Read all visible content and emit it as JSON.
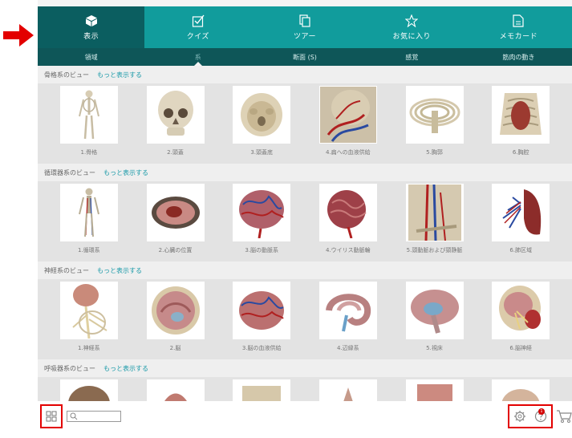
{
  "top_tabs": [
    {
      "label": "表示",
      "icon": "cube-icon"
    },
    {
      "label": "クイズ",
      "icon": "checkbox-icon"
    },
    {
      "label": "ツアー",
      "icon": "pages-icon"
    },
    {
      "label": "お気に入り",
      "icon": "star-icon"
    },
    {
      "label": "メモカード",
      "icon": "card-icon"
    }
  ],
  "sub_tabs": [
    {
      "label": "領域"
    },
    {
      "label": "系"
    },
    {
      "label": "断面 (S)"
    },
    {
      "label": "感覚"
    },
    {
      "label": "筋肉の動き"
    }
  ],
  "sections": [
    {
      "title": "骨格系のビュー",
      "more": "もっと表示する",
      "items": [
        "1.骨格",
        "2.頭蓋",
        "3.頭蓋底",
        "4.扁への血液供給",
        "5.胸郭",
        "6.胸腔"
      ]
    },
    {
      "title": "循環器系のビュー",
      "more": "もっと表示する",
      "items": [
        "1.循環系",
        "2.心臓の位置",
        "3.脳の動脈系",
        "4.ウイリス動脈輪",
        "5.頭動脈および頸静脈",
        "6.肺区域"
      ]
    },
    {
      "title": "神経系のビュー",
      "more": "もっと表示する",
      "items": [
        "1.神経系",
        "2.脳",
        "3.脳の血液供給",
        "4.辺縁系",
        "5.視床",
        "6.脳神経"
      ]
    },
    {
      "title": "呼吸器系のビュー",
      "more": "もっと表示する"
    }
  ],
  "bottom": {
    "search_placeholder": "",
    "help_badge": "1"
  },
  "colors": {
    "nav": "#119c9c",
    "nav_active": "#0b5e60",
    "subnav": "#0e5658",
    "link": "#1a9aa8",
    "highlight": "#e30000"
  }
}
